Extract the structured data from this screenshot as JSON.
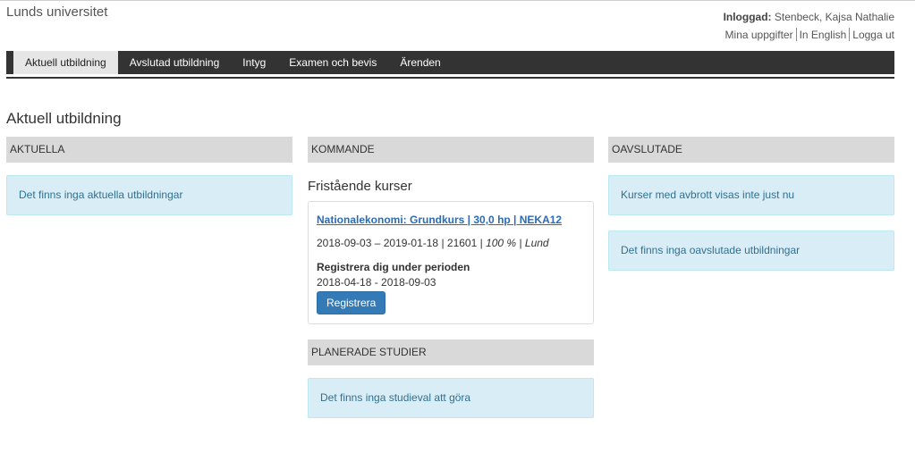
{
  "brand": "Lunds universitet",
  "user": {
    "logged_in_label": "Inloggad:",
    "name": "Stenbeck, Kajsa Nathalie",
    "links": [
      "Mina uppgifter",
      "In English",
      "Logga ut"
    ]
  },
  "nav": {
    "tabs": [
      "Aktuell utbildning",
      "Avslutad utbildning",
      "Intyg",
      "Examen och bevis",
      "Ärenden"
    ],
    "active_index": 0
  },
  "page_title": "Aktuell utbildning",
  "aktuella": {
    "header": "AKTUELLA",
    "message": "Det finns inga aktuella utbildningar"
  },
  "kommande": {
    "header": "KOMMANDE",
    "section_title": "Fristående kurser",
    "course": {
      "title": "Nationalekonomi: Grundkurs | 30,0 hp | NEKA12",
      "dates": "2018-09-03 – 2019-01-18",
      "code": "21601",
      "pace": "100 %",
      "location": "Lund",
      "register_label": "Registrera dig under perioden",
      "register_period": "2018-04-18 - 2018-09-03",
      "register_button": "Registrera"
    }
  },
  "planerade": {
    "header": "PLANERADE STUDIER",
    "message": "Det finns inga studieval att göra"
  },
  "oavslutade": {
    "header": "OAVSLUTADE",
    "messages": [
      "Kurser med avbrott visas inte just nu",
      "Det finns inga oavslutade utbildningar"
    ]
  },
  "colors": {
    "nav_bg": "#333333",
    "info_bg": "#d9edf7",
    "info_text": "#31708f",
    "panel_header_bg": "#d9d9d9",
    "button_bg": "#337ab7",
    "link": "#2a6cb5"
  }
}
